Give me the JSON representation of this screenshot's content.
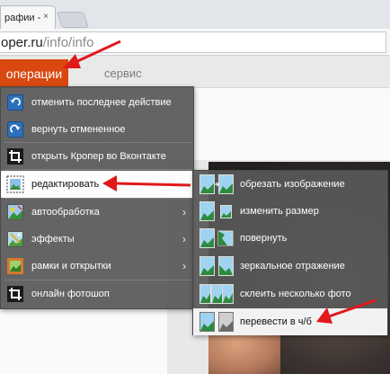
{
  "browser": {
    "tab_title": "рафии -",
    "tab_close": "×",
    "url_host": "oper.ru",
    "url_path": "/info/info"
  },
  "nav": {
    "operations": "операции",
    "service": "сервис"
  },
  "main_menu": {
    "items": [
      {
        "label": "отменить последнее действие",
        "icon": "undo-icon"
      },
      {
        "label": "вернуть отмененное",
        "icon": "redo-icon"
      },
      {
        "label": "открыть Кропер во Вконтакте",
        "icon": "crop-icon"
      },
      {
        "label": "редактировать",
        "icon": "edit-icon",
        "arrow": "›",
        "highlighted": true
      },
      {
        "label": "автообработка",
        "icon": "auto-icon",
        "arrow": "›"
      },
      {
        "label": "эффекты",
        "icon": "effects-icon",
        "arrow": "›"
      },
      {
        "label": "рамки и открытки",
        "icon": "frames-icon",
        "arrow": "›"
      },
      {
        "label": "онлайн фотошоп",
        "icon": "crop-icon"
      }
    ]
  },
  "sub_menu": {
    "items": [
      {
        "label": "обрезать изображение"
      },
      {
        "label": "изменить размер"
      },
      {
        "label": "повернуть"
      },
      {
        "label": "зеркальное отражение"
      },
      {
        "label": "склеить несколько фото"
      },
      {
        "label": "перевести в ч/б",
        "highlighted": true
      }
    ]
  },
  "colors": {
    "accent": "#d9480f",
    "menu_bg": "#585858",
    "arrow": "#e0191b"
  }
}
